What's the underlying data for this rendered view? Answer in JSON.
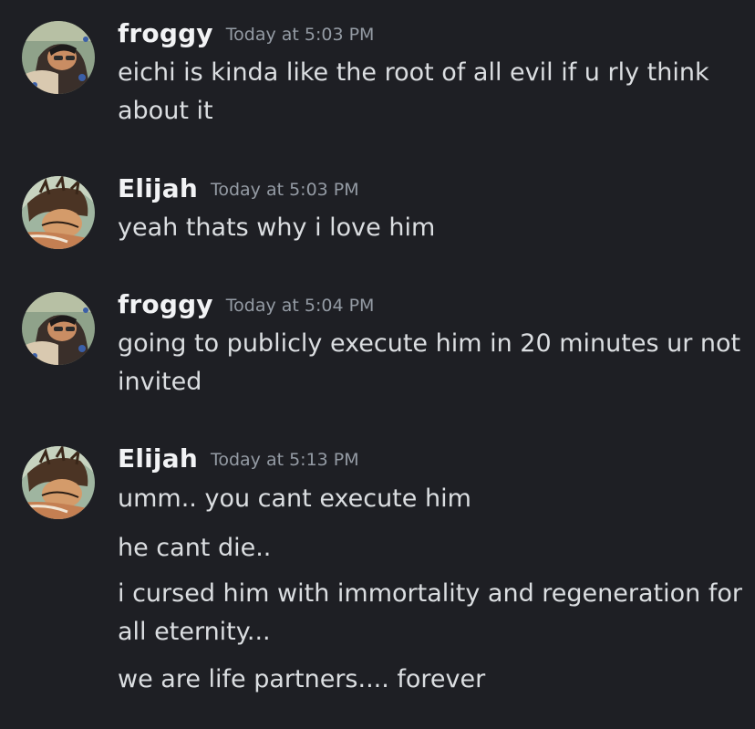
{
  "chat": {
    "groups": [
      {
        "user": "froggy",
        "avatar": "froggy-avatar",
        "time": "Today at 5:03 PM",
        "lines": [
          "eichi is kinda like the root of all evil if u rly think about it"
        ]
      },
      {
        "user": "Elijah",
        "avatar": "elijah-avatar",
        "time": "Today at 5:03 PM",
        "lines": [
          "yeah thats why i love him"
        ]
      },
      {
        "user": "froggy",
        "avatar": "froggy-avatar",
        "time": "Today at 5:04 PM",
        "lines": [
          "going to publicly execute him in 20 minutes ur not invited"
        ]
      },
      {
        "user": "Elijah",
        "avatar": "elijah-avatar",
        "time": "Today at 5:13 PM",
        "lines": [
          "umm.. you cant execute him",
          "he cant die..",
          "i cursed him with immortality and regeneration for all eternity...",
          "we are life partners.... forever"
        ]
      }
    ]
  },
  "colors": {
    "background": "#1e1f24",
    "username": "#f2f3f5",
    "timestamp": "#949ba4",
    "message_text": "#dbdee1"
  }
}
